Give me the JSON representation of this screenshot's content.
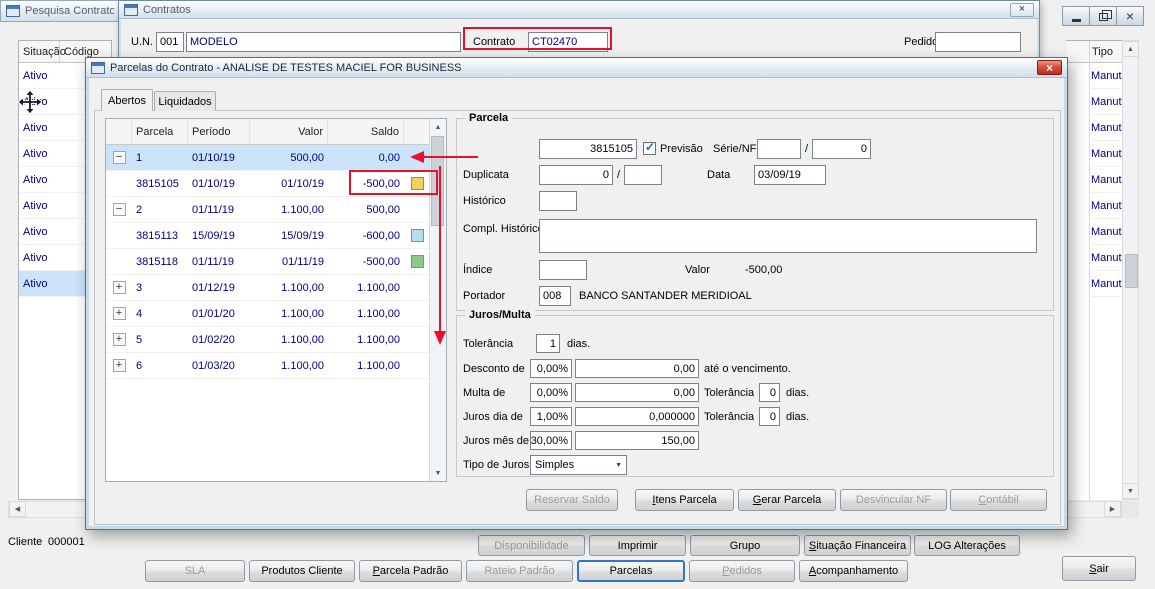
{
  "pesquisa_window": {
    "title": "Pesquisa Contrato",
    "grid": {
      "col_situacao": "Situação",
      "col_codigo": "Código",
      "rows": [
        "Ativo",
        "Ativo",
        "Ativo",
        "Ativo",
        "Ativo",
        "Ativo",
        "Ativo",
        "Ativo",
        "Ativo"
      ],
      "selected_index": 8
    },
    "tipo_column": {
      "header": "Tipo",
      "rows": [
        "Manutenç",
        "Manutenç",
        "Manutenç",
        "Manutenç",
        "Manutenç",
        "Manutenç",
        "Manutenç",
        "Manutenç",
        "Manutenç"
      ]
    },
    "cliente_label": "Cliente",
    "cliente_value": "000001"
  },
  "contratos_window": {
    "title": "Contratos",
    "fields": {
      "un_label": "U.N.",
      "un_code": "001",
      "un_name": "MODELO",
      "contrato_label": "Contrato",
      "contrato_value": "CT02470",
      "pedido_label": "Pedido",
      "pedido_value": ""
    }
  },
  "parcelas_dialog": {
    "title": "Parcelas do Contrato - ANALISE DE TESTES MACIEL FOR BUSINESS",
    "tabs": [
      {
        "label": "Abertos",
        "active": true
      },
      {
        "label": "Liquidados",
        "active": false
      }
    ],
    "grid": {
      "columns": [
        "Parcela",
        "Período",
        "Valor",
        "Saldo"
      ],
      "rows": [
        {
          "expand": "minus",
          "parcela": "1",
          "periodo": "01/10/19",
          "valor": "500,00",
          "saldo": "0,00",
          "selected": true
        },
        {
          "expand": "",
          "parcela": "3815105",
          "periodo": "01/10/19",
          "valor": "01/10/19",
          "saldo": "-500,00",
          "marker_color": "#f0d060"
        },
        {
          "expand": "minus",
          "parcela": "2",
          "periodo": "01/11/19",
          "valor": "1.100,00",
          "saldo": "500,00"
        },
        {
          "expand": "",
          "parcela": "3815113",
          "periodo": "15/09/19",
          "valor": "15/09/19",
          "saldo": "-600,00",
          "marker_color": "#b5dff0"
        },
        {
          "expand": "",
          "parcela": "3815118",
          "periodo": "01/11/19",
          "valor": "01/11/19",
          "saldo": "-500,00",
          "marker_color": "#8cc98c"
        },
        {
          "expand": "plus",
          "parcela": "3",
          "periodo": "01/12/19",
          "valor": "1.100,00",
          "saldo": "1.100,00"
        },
        {
          "expand": "plus",
          "parcela": "4",
          "periodo": "01/01/20",
          "valor": "1.100,00",
          "saldo": "1.100,00"
        },
        {
          "expand": "plus",
          "parcela": "5",
          "periodo": "01/02/20",
          "valor": "1.100,00",
          "saldo": "1.100,00"
        },
        {
          "expand": "plus",
          "parcela": "6",
          "periodo": "01/03/20",
          "valor": "1.100,00",
          "saldo": "1.100,00"
        }
      ]
    },
    "parcela_group": {
      "legend": "Parcela",
      "numero_value": "3815105",
      "previsao_label": "Previsão",
      "previsao_checked": true,
      "serie_nf_label": "Série/NF",
      "serie_value": "",
      "serie_sep": "/",
      "nf_value": "0",
      "duplicata_label": "Duplicata",
      "duplicata_value": "0",
      "duplicata_sep": "/",
      "duplicata_seq": "",
      "data_label": "Data",
      "data_value": "03/09/19",
      "historico_label": "Histórico",
      "historico_value": "",
      "compl_historico_label": "Compl. Histórico",
      "compl_historico_value": "",
      "indice_label": "Índice",
      "indice_value": "",
      "valor_label": "Valor",
      "valor_value": "-500,00",
      "portador_label": "Portador",
      "portador_code": "008",
      "portador_name": "BANCO SANTANDER MERIDIOAL"
    },
    "juros_group": {
      "legend": "Juros/Multa",
      "tolerancia_label": "Tolerância",
      "tolerancia_value": "1",
      "dias_label": "dias.",
      "desconto_label": "Desconto de",
      "desconto_pct": "0,00%",
      "desconto_valor": "0,00",
      "ate_vencimento_label": "até o vencimento.",
      "multa_label": "Multa de",
      "multa_pct": "0,00%",
      "multa_valor": "0,00",
      "multa_tolerancia_label": "Tolerância",
      "multa_tolerancia_value": "0",
      "multa_dias_label": "dias.",
      "juros_dia_label": "Juros dia de",
      "juros_dia_pct": "1,00%",
      "juros_dia_valor": "0,000000",
      "juros_dia_tolerancia_label": "Tolerância",
      "juros_dia_tolerancia_value": "0",
      "juros_dia_dias_label": "dias.",
      "juros_mes_label": "Juros mês de",
      "juros_mes_pct": "30,00%",
      "juros_mes_valor": "150,00",
      "tipo_juros_label": "Tipo de Juros",
      "tipo_juros_value": "Simples"
    },
    "buttons": [
      {
        "label": "Reservar Saldo",
        "disabled": true
      },
      {
        "label": "Itens Parcela",
        "disabled": false,
        "underline_first": true
      },
      {
        "label": "Gerar Parcela",
        "disabled": false,
        "underline_first": true
      },
      {
        "label": "Desvincular NF",
        "disabled": true
      },
      {
        "label": "Contábil",
        "disabled": true,
        "underline_first": true
      }
    ]
  },
  "bottom_bar": {
    "row1": [
      {
        "label": "Disponibilidade",
        "disabled": true
      },
      {
        "label": "Imprimir",
        "disabled": false
      },
      {
        "label": "Grupo",
        "disabled": false
      },
      {
        "label": "Situação Financeira",
        "disabled": false,
        "underline_first": true
      },
      {
        "label": "LOG Alterações",
        "disabled": false
      }
    ],
    "row2": [
      {
        "label": "SLA",
        "disabled": true
      },
      {
        "label": "Produtos Cliente",
        "disabled": false
      },
      {
        "label": "Parcela Padrão",
        "disabled": false,
        "underline_first": true
      },
      {
        "label": "Rateio Padrão",
        "disabled": true
      },
      {
        "label": "Parcelas",
        "disabled": false,
        "focused": true
      },
      {
        "label": "Pedidos",
        "disabled": true,
        "underline_first": true
      },
      {
        "label": "Acompanhamento",
        "disabled": false,
        "underline_first": true
      }
    ],
    "sair_label": "Sair"
  },
  "annotations": [
    {
      "shape": "box",
      "color": "#e8112d",
      "points_to": "Contrato CT02470 field"
    },
    {
      "shape": "box",
      "color": "#e8112d",
      "points_to": "saldo -500,00 of duplicata 3815105"
    },
    {
      "shape": "arrow-left",
      "color": "#e8112d",
      "points_to": "saldo 0,00 of parcela 1"
    },
    {
      "shape": "arrow-down",
      "color": "#e8112d",
      "points_to": "parcela rows below"
    }
  ],
  "colors": {
    "highlight_red": "#e8112d",
    "selection_blue": "#cce4fa",
    "data_navy": "#000080",
    "marker_yellow": "#f0d060",
    "marker_blue": "#b5dff0",
    "marker_green": "#8cc98c"
  }
}
